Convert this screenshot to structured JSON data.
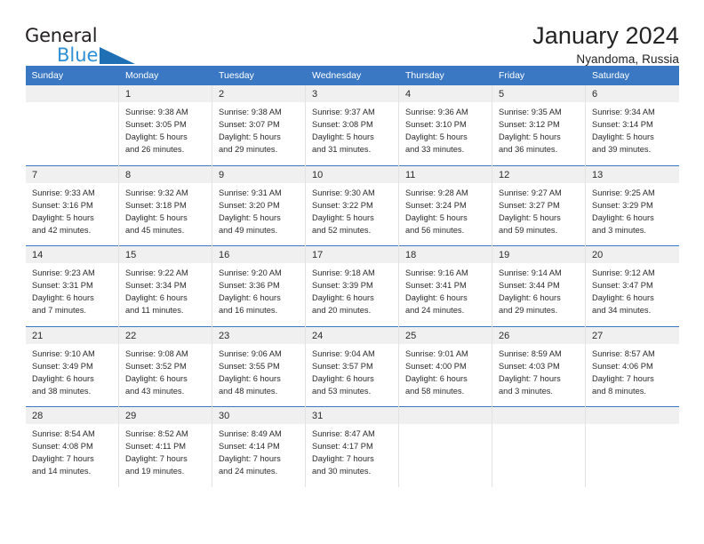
{
  "brand": {
    "name_top": "General",
    "name_bottom": "Blue",
    "accent_color": "#2f8fd4",
    "triangle_color": "#1f6fb5"
  },
  "header": {
    "title": "January 2024",
    "subtitle": "Nyandoma, Russia"
  },
  "calendar": {
    "header_color": "#3b78c3",
    "daynum_bg": "#f0f0f0",
    "weekdays": [
      "Sunday",
      "Monday",
      "Tuesday",
      "Wednesday",
      "Thursday",
      "Friday",
      "Saturday"
    ],
    "weeks": [
      [
        {
          "day": "",
          "sunrise": "",
          "sunset": "",
          "daylight1": "",
          "daylight2": ""
        },
        {
          "day": "1",
          "sunrise": "Sunrise: 9:38 AM",
          "sunset": "Sunset: 3:05 PM",
          "daylight1": "Daylight: 5 hours",
          "daylight2": "and 26 minutes."
        },
        {
          "day": "2",
          "sunrise": "Sunrise: 9:38 AM",
          "sunset": "Sunset: 3:07 PM",
          "daylight1": "Daylight: 5 hours",
          "daylight2": "and 29 minutes."
        },
        {
          "day": "3",
          "sunrise": "Sunrise: 9:37 AM",
          "sunset": "Sunset: 3:08 PM",
          "daylight1": "Daylight: 5 hours",
          "daylight2": "and 31 minutes."
        },
        {
          "day": "4",
          "sunrise": "Sunrise: 9:36 AM",
          "sunset": "Sunset: 3:10 PM",
          "daylight1": "Daylight: 5 hours",
          "daylight2": "and 33 minutes."
        },
        {
          "day": "5",
          "sunrise": "Sunrise: 9:35 AM",
          "sunset": "Sunset: 3:12 PM",
          "daylight1": "Daylight: 5 hours",
          "daylight2": "and 36 minutes."
        },
        {
          "day": "6",
          "sunrise": "Sunrise: 9:34 AM",
          "sunset": "Sunset: 3:14 PM",
          "daylight1": "Daylight: 5 hours",
          "daylight2": "and 39 minutes."
        }
      ],
      [
        {
          "day": "7",
          "sunrise": "Sunrise: 9:33 AM",
          "sunset": "Sunset: 3:16 PM",
          "daylight1": "Daylight: 5 hours",
          "daylight2": "and 42 minutes."
        },
        {
          "day": "8",
          "sunrise": "Sunrise: 9:32 AM",
          "sunset": "Sunset: 3:18 PM",
          "daylight1": "Daylight: 5 hours",
          "daylight2": "and 45 minutes."
        },
        {
          "day": "9",
          "sunrise": "Sunrise: 9:31 AM",
          "sunset": "Sunset: 3:20 PM",
          "daylight1": "Daylight: 5 hours",
          "daylight2": "and 49 minutes."
        },
        {
          "day": "10",
          "sunrise": "Sunrise: 9:30 AM",
          "sunset": "Sunset: 3:22 PM",
          "daylight1": "Daylight: 5 hours",
          "daylight2": "and 52 minutes."
        },
        {
          "day": "11",
          "sunrise": "Sunrise: 9:28 AM",
          "sunset": "Sunset: 3:24 PM",
          "daylight1": "Daylight: 5 hours",
          "daylight2": "and 56 minutes."
        },
        {
          "day": "12",
          "sunrise": "Sunrise: 9:27 AM",
          "sunset": "Sunset: 3:27 PM",
          "daylight1": "Daylight: 5 hours",
          "daylight2": "and 59 minutes."
        },
        {
          "day": "13",
          "sunrise": "Sunrise: 9:25 AM",
          "sunset": "Sunset: 3:29 PM",
          "daylight1": "Daylight: 6 hours",
          "daylight2": "and 3 minutes."
        }
      ],
      [
        {
          "day": "14",
          "sunrise": "Sunrise: 9:23 AM",
          "sunset": "Sunset: 3:31 PM",
          "daylight1": "Daylight: 6 hours",
          "daylight2": "and 7 minutes."
        },
        {
          "day": "15",
          "sunrise": "Sunrise: 9:22 AM",
          "sunset": "Sunset: 3:34 PM",
          "daylight1": "Daylight: 6 hours",
          "daylight2": "and 11 minutes."
        },
        {
          "day": "16",
          "sunrise": "Sunrise: 9:20 AM",
          "sunset": "Sunset: 3:36 PM",
          "daylight1": "Daylight: 6 hours",
          "daylight2": "and 16 minutes."
        },
        {
          "day": "17",
          "sunrise": "Sunrise: 9:18 AM",
          "sunset": "Sunset: 3:39 PM",
          "daylight1": "Daylight: 6 hours",
          "daylight2": "and 20 minutes."
        },
        {
          "day": "18",
          "sunrise": "Sunrise: 9:16 AM",
          "sunset": "Sunset: 3:41 PM",
          "daylight1": "Daylight: 6 hours",
          "daylight2": "and 24 minutes."
        },
        {
          "day": "19",
          "sunrise": "Sunrise: 9:14 AM",
          "sunset": "Sunset: 3:44 PM",
          "daylight1": "Daylight: 6 hours",
          "daylight2": "and 29 minutes."
        },
        {
          "day": "20",
          "sunrise": "Sunrise: 9:12 AM",
          "sunset": "Sunset: 3:47 PM",
          "daylight1": "Daylight: 6 hours",
          "daylight2": "and 34 minutes."
        }
      ],
      [
        {
          "day": "21",
          "sunrise": "Sunrise: 9:10 AM",
          "sunset": "Sunset: 3:49 PM",
          "daylight1": "Daylight: 6 hours",
          "daylight2": "and 38 minutes."
        },
        {
          "day": "22",
          "sunrise": "Sunrise: 9:08 AM",
          "sunset": "Sunset: 3:52 PM",
          "daylight1": "Daylight: 6 hours",
          "daylight2": "and 43 minutes."
        },
        {
          "day": "23",
          "sunrise": "Sunrise: 9:06 AM",
          "sunset": "Sunset: 3:55 PM",
          "daylight1": "Daylight: 6 hours",
          "daylight2": "and 48 minutes."
        },
        {
          "day": "24",
          "sunrise": "Sunrise: 9:04 AM",
          "sunset": "Sunset: 3:57 PM",
          "daylight1": "Daylight: 6 hours",
          "daylight2": "and 53 minutes."
        },
        {
          "day": "25",
          "sunrise": "Sunrise: 9:01 AM",
          "sunset": "Sunset: 4:00 PM",
          "daylight1": "Daylight: 6 hours",
          "daylight2": "and 58 minutes."
        },
        {
          "day": "26",
          "sunrise": "Sunrise: 8:59 AM",
          "sunset": "Sunset: 4:03 PM",
          "daylight1": "Daylight: 7 hours",
          "daylight2": "and 3 minutes."
        },
        {
          "day": "27",
          "sunrise": "Sunrise: 8:57 AM",
          "sunset": "Sunset: 4:06 PM",
          "daylight1": "Daylight: 7 hours",
          "daylight2": "and 8 minutes."
        }
      ],
      [
        {
          "day": "28",
          "sunrise": "Sunrise: 8:54 AM",
          "sunset": "Sunset: 4:08 PM",
          "daylight1": "Daylight: 7 hours",
          "daylight2": "and 14 minutes."
        },
        {
          "day": "29",
          "sunrise": "Sunrise: 8:52 AM",
          "sunset": "Sunset: 4:11 PM",
          "daylight1": "Daylight: 7 hours",
          "daylight2": "and 19 minutes."
        },
        {
          "day": "30",
          "sunrise": "Sunrise: 8:49 AM",
          "sunset": "Sunset: 4:14 PM",
          "daylight1": "Daylight: 7 hours",
          "daylight2": "and 24 minutes."
        },
        {
          "day": "31",
          "sunrise": "Sunrise: 8:47 AM",
          "sunset": "Sunset: 4:17 PM",
          "daylight1": "Daylight: 7 hours",
          "daylight2": "and 30 minutes."
        },
        {
          "day": "",
          "sunrise": "",
          "sunset": "",
          "daylight1": "",
          "daylight2": ""
        },
        {
          "day": "",
          "sunrise": "",
          "sunset": "",
          "daylight1": "",
          "daylight2": ""
        },
        {
          "day": "",
          "sunrise": "",
          "sunset": "",
          "daylight1": "",
          "daylight2": ""
        }
      ]
    ]
  }
}
